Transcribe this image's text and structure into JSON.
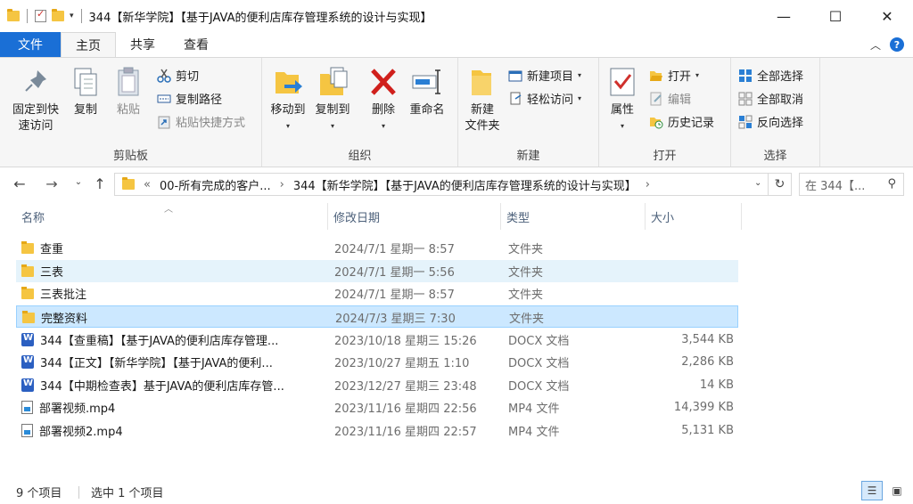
{
  "window": {
    "title": "344【新华学院】【基于JAVA的便利店库存管理系统的设计与实现】",
    "minimize": "—",
    "maximize": "☐",
    "close": "✕"
  },
  "tabs": [
    {
      "label": "文件"
    },
    {
      "label": "主页"
    },
    {
      "label": "共享"
    },
    {
      "label": "查看"
    }
  ],
  "ribbon": {
    "clipboard": {
      "label": "剪贴板",
      "pin_line1": "固定到快",
      "pin_line2": "速访问",
      "copy": "复制",
      "paste": "粘贴",
      "cut": "剪切",
      "copy_path": "复制路径",
      "paste_shortcut": "粘贴快捷方式"
    },
    "organize": {
      "label": "组织",
      "move_to": "移动到",
      "copy_to": "复制到",
      "delete": "删除",
      "rename": "重命名"
    },
    "new": {
      "label": "新建",
      "new_folder_line1": "新建",
      "new_folder_line2": "文件夹",
      "new_item": "新建项目",
      "easy_access": "轻松访问"
    },
    "open": {
      "label": "打开",
      "properties": "属性",
      "open": "打开",
      "edit": "编辑",
      "history": "历史记录"
    },
    "select": {
      "label": "选择",
      "select_all": "全部选择",
      "select_none": "全部取消",
      "invert": "反向选择"
    }
  },
  "address": {
    "overflow": "«",
    "crumb1": "00-所有完成的客户...",
    "crumb2": "344【新华学院】【基于JAVA的便利店库存管理系统的设计与实现】",
    "search_placeholder": "在 344【..."
  },
  "columns": {
    "name": "名称",
    "date": "修改日期",
    "type": "类型",
    "size": "大小"
  },
  "files": [
    {
      "name": "查重",
      "date": "2024/7/1 星期一 8:57",
      "type": "文件夹",
      "size": "",
      "icon": "folder"
    },
    {
      "name": "三表",
      "date": "2024/7/1 星期一 5:56",
      "type": "文件夹",
      "size": "",
      "icon": "folder"
    },
    {
      "name": "三表批注",
      "date": "2024/7/1 星期一 8:57",
      "type": "文件夹",
      "size": "",
      "icon": "folder"
    },
    {
      "name": "完整资料",
      "date": "2024/7/3 星期三 7:30",
      "type": "文件夹",
      "size": "",
      "icon": "folder"
    },
    {
      "name": "344【查重稿】【基于JAVA的便利店库存管理...",
      "date": "2023/10/18 星期三 15:26",
      "type": "DOCX 文档",
      "size": "3,544 KB",
      "icon": "docx"
    },
    {
      "name": "344【正文】【新华学院】【基于JAVA的便利...",
      "date": "2023/10/27 星期五 1:10",
      "type": "DOCX 文档",
      "size": "2,286 KB",
      "icon": "docx"
    },
    {
      "name": "344【中期检查表】基于JAVA的便利店库存管...",
      "date": "2023/12/27 星期三 23:48",
      "type": "DOCX 文档",
      "size": "14 KB",
      "icon": "docx"
    },
    {
      "name": "部署视频.mp4",
      "date": "2023/11/16 星期四 22:56",
      "type": "MP4 文件",
      "size": "14,399 KB",
      "icon": "mp4"
    },
    {
      "name": "部署视频2.mp4",
      "date": "2023/11/16 星期四 22:57",
      "type": "MP4 文件",
      "size": "5,131 KB",
      "icon": "mp4"
    }
  ],
  "status": {
    "count": "9 个项目",
    "selected": "选中 1 个项目"
  }
}
